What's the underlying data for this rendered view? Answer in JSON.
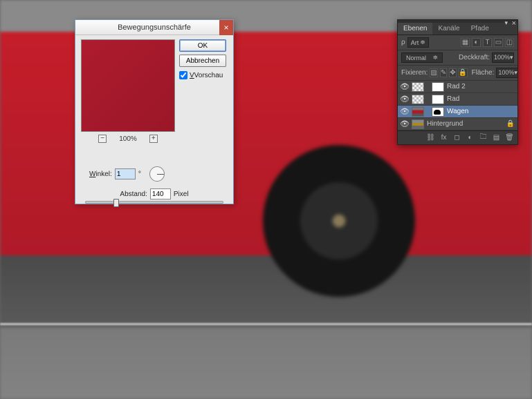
{
  "dialog": {
    "title": "Bewegungsunschärfe",
    "ok": "OK",
    "cancel": "Abbrechen",
    "preview_label": "Vorschau",
    "preview_underline": "V",
    "zoom_level": "100%",
    "angle_label": "inkel:",
    "angle_underline": "W",
    "angle_value": "1",
    "angle_unit": "°",
    "distance_label": "Abstand:",
    "distance_value": "140",
    "distance_unit": "Pixel"
  },
  "panel": {
    "tabs": [
      "Ebenen",
      "Kanäle",
      "Pfade"
    ],
    "active_tab": 0,
    "search_label": "ρ",
    "search_mode": "Art",
    "blend_mode": "Normal",
    "opacity_label": "Deckkraft:",
    "opacity_value": "100%",
    "lock_label": "Fixieren:",
    "fill_label": "Fläche:",
    "fill_value": "100%",
    "layers": [
      {
        "name": "Rad 2",
        "visible": true,
        "selected": false,
        "thumb": "trans",
        "mask": "maskfull"
      },
      {
        "name": "Rad",
        "visible": true,
        "selected": false,
        "thumb": "trans",
        "mask": "maskfull"
      },
      {
        "name": "Wagen",
        "visible": true,
        "selected": true,
        "thumb": "car",
        "mask": "mask"
      },
      {
        "name": "Hintergrund",
        "visible": true,
        "selected": false,
        "thumb": "bgimg",
        "mask": null,
        "locked": true
      }
    ]
  }
}
